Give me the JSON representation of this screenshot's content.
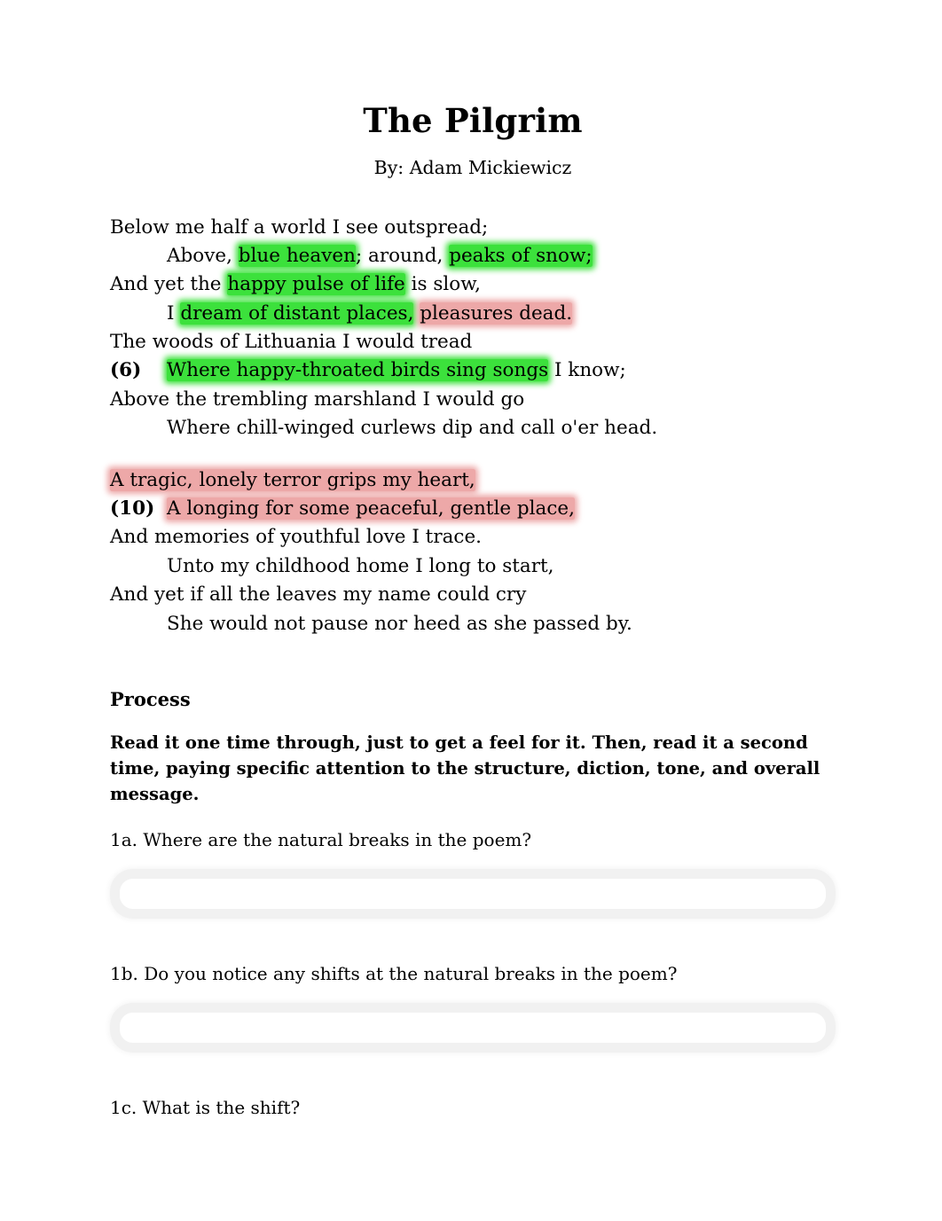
{
  "document": {
    "title": "The Pilgrim",
    "byline": "By: Adam Mickiewicz"
  },
  "colors": {
    "highlight_green": "#3ce13c",
    "highlight_pink": "#eda8a8",
    "text": "#000000",
    "page_background": "#ffffff",
    "answer_box_border": "#f1f1f1"
  },
  "poem": {
    "stanza1": {
      "line1": {
        "indent": false,
        "number": "",
        "segments": [
          {
            "text": "Below me half a world I see outspread;",
            "highlight": "none"
          }
        ]
      },
      "line2": {
        "indent": true,
        "number": "",
        "segments": [
          {
            "text": "Above, ",
            "highlight": "none"
          },
          {
            "text": "blue heaven",
            "highlight": "green"
          },
          {
            "text": "; around, ",
            "highlight": "none"
          },
          {
            "text": "peaks of snow;",
            "highlight": "green"
          }
        ]
      },
      "line3": {
        "indent": false,
        "number": "",
        "segments": [
          {
            "text": "And yet the ",
            "highlight": "none"
          },
          {
            "text": "happy pulse of life",
            "highlight": "green"
          },
          {
            "text": " is slow,",
            "highlight": "none"
          }
        ]
      },
      "line4": {
        "indent": true,
        "number": "",
        "segments": [
          {
            "text": "I ",
            "highlight": "none"
          },
          {
            "text": "dream of distant places,",
            "highlight": "green"
          },
          {
            "text": " ",
            "highlight": "none"
          },
          {
            "text": "pleasures dead.",
            "highlight": "pink"
          }
        ]
      },
      "line5": {
        "indent": false,
        "number": "",
        "segments": [
          {
            "text": "The woods of Lithuania I would tread",
            "highlight": "none"
          }
        ]
      },
      "line6": {
        "indent": false,
        "number": "(6)",
        "segments": [
          {
            "text": "Where happy-throated birds sing songs",
            "highlight": "green"
          },
          {
            "text": " I know;",
            "highlight": "none"
          }
        ]
      },
      "line7": {
        "indent": false,
        "number": "",
        "segments": [
          {
            "text": "Above the trembling marshland I would go",
            "highlight": "none"
          }
        ]
      },
      "line8": {
        "indent": true,
        "number": "",
        "segments": [
          {
            "text": "Where chill-winged curlews dip and call o'er head.",
            "highlight": "none"
          }
        ]
      }
    },
    "stanza2": {
      "line9": {
        "indent": false,
        "number": "",
        "segments": [
          {
            "text": "A tragic, lonely terror grips my heart,",
            "highlight": "pink"
          }
        ]
      },
      "line10": {
        "indent": false,
        "number": "(10)",
        "segments": [
          {
            "text": "A longing for some peaceful, gentle place,",
            "highlight": "pink"
          }
        ]
      },
      "line11": {
        "indent": false,
        "number": "",
        "segments": [
          {
            "text": "And memories of youthful love I trace.",
            "highlight": "none"
          }
        ]
      },
      "line12": {
        "indent": true,
        "number": "",
        "segments": [
          {
            "text": "Unto my childhood home I long to start,",
            "highlight": "none"
          }
        ]
      },
      "line13": {
        "indent": false,
        "number": "",
        "segments": [
          {
            "text": "And yet if all the leaves my name could cry",
            "highlight": "none"
          }
        ]
      },
      "line14": {
        "indent": true,
        "number": "",
        "segments": [
          {
            "text": "She would not pause nor heed as she passed by.",
            "highlight": "none"
          }
        ]
      }
    }
  },
  "process": {
    "heading": "Process",
    "instructions": "Read it one time through, just to get a feel for it.  Then, read it a second time, paying specific attention to the structure, diction, tone, and overall message.",
    "questions": {
      "q1a": {
        "label": "1a. Where are the natural breaks in the poem?",
        "answer": "",
        "placeholder": ""
      },
      "q1b": {
        "label": "1b. Do you notice any shifts at the natural breaks in the poem?",
        "answer": "",
        "placeholder": ""
      },
      "q1c": {
        "label": "1c. What is the shift?",
        "answer": "",
        "placeholder": ""
      }
    }
  }
}
